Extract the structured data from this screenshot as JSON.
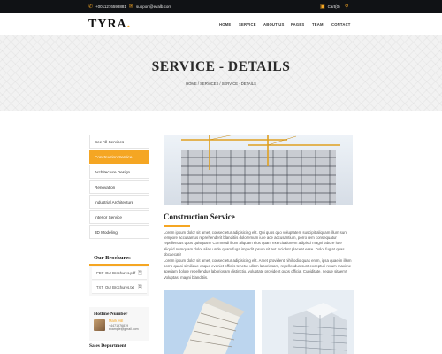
{
  "topbar": {
    "phone": "+0011276598881",
    "email": "support@evalb.com",
    "cart": "Cart(0)"
  },
  "header": {
    "logo": "TYRA",
    "logo_dot": ".",
    "nav": [
      "HOME",
      "SERVICE",
      "ABOUT US",
      "PAGES",
      "TEAM",
      "CONTACT"
    ]
  },
  "banner": {
    "title": "SERVICE - DETAILS",
    "breadcrumb": "HOME  /  SERVICES  /  SERVICE - DETAILS"
  },
  "sidebar": {
    "items": [
      {
        "label": "See All Services",
        "active": false
      },
      {
        "label": "Construction Service",
        "active": true
      },
      {
        "label": "Architecture Design",
        "active": false
      },
      {
        "label": "Renovation",
        "active": false
      },
      {
        "label": "Industrial Architecture",
        "active": false
      },
      {
        "label": "Interior Service",
        "active": false
      },
      {
        "label": "3D Modeling",
        "active": false
      }
    ],
    "brochures": {
      "title": "Our Brochures",
      "files": [
        {
          "type": "PDF",
          "name": "Our Brochures.pdf"
        },
        {
          "type": "TXT",
          "name": "Our Brochures.txt"
        }
      ]
    },
    "hotline": {
      "title": "Hotline Number",
      "name": "Mark Hill",
      "phone": "+4471976819",
      "email": "example@gmail.com"
    },
    "sales_title": "Sales Department"
  },
  "content": {
    "title": "Construction Service",
    "paragraph1": "Lorem ipsum dolor sit amet, consectetur adipisicing elit. Qui quos quo voluptatem suscipit aliquam illum sunt tempore accusamus reprehenderit blanditiis doloremum iure ace accusantium, porro rem consequatur repellendus quos quisquam! Commodi illum aliquam eius quam exercitationem adipisci magni labore iure aliquid numquam dolor alias unde quam fuga impedit ipsum sit aut incidunt placeat esse. Dolor fugiat quas obcaecati!",
    "paragraph2": "Lorem ipsum dolor sit amet, consectetur adipisicing elit. Amet provident nihil odio quas enim, ipsa quae in illum porro quasi similique esque eveniet officiis tenetur ullam laboriosam, repellendus sunt excepturi rerum maxime aperiam dolore repellendus laboriosam distinctio, voluptate provident quos officia. Cupiditate, neque sitaem! Voluptas, magni blanditiis."
  },
  "colors": {
    "accent": "#f5a623",
    "topbar": "#101215"
  }
}
